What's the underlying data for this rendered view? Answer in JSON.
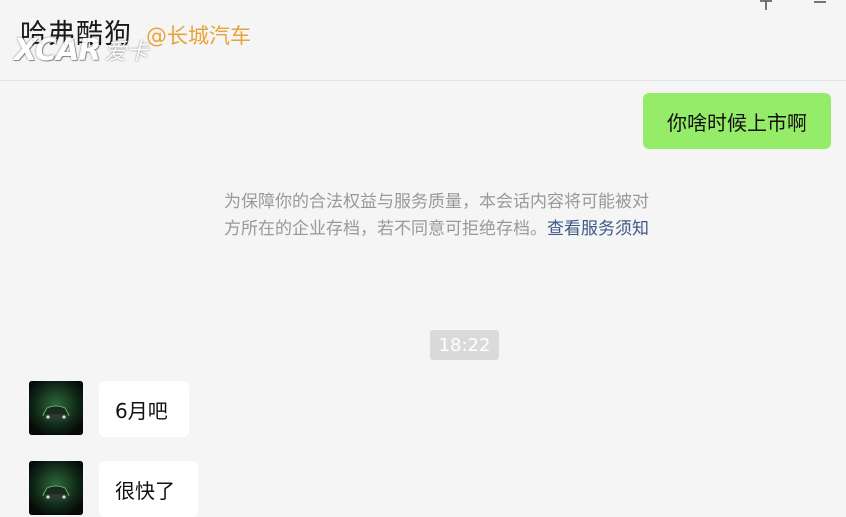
{
  "header": {
    "title": "哈弗酷狗",
    "company": "@长城汽车"
  },
  "watermark": {
    "text": "XCAR",
    "sub": "爱卡"
  },
  "icons": {
    "pin": "pin-icon",
    "more": "more-icon",
    "avatar": "car-avatar"
  },
  "colors": {
    "self_bubble": "#95ec69",
    "company_tag": "#e8a33b",
    "link": "#3e5a86"
  },
  "messages": [
    {
      "sender": "self",
      "text": "你啥时候上市啊"
    },
    {
      "sender": "other",
      "text": "6月吧"
    },
    {
      "sender": "other",
      "text": "很快了"
    }
  ],
  "system_notice": {
    "line1": "为保障你的合法权益与服务质量，本会话内容将可能被对",
    "line2": "方所在的企业存档，若不同意可拒绝存档。",
    "link": "查看服务须知"
  },
  "timestamp": "18:22"
}
